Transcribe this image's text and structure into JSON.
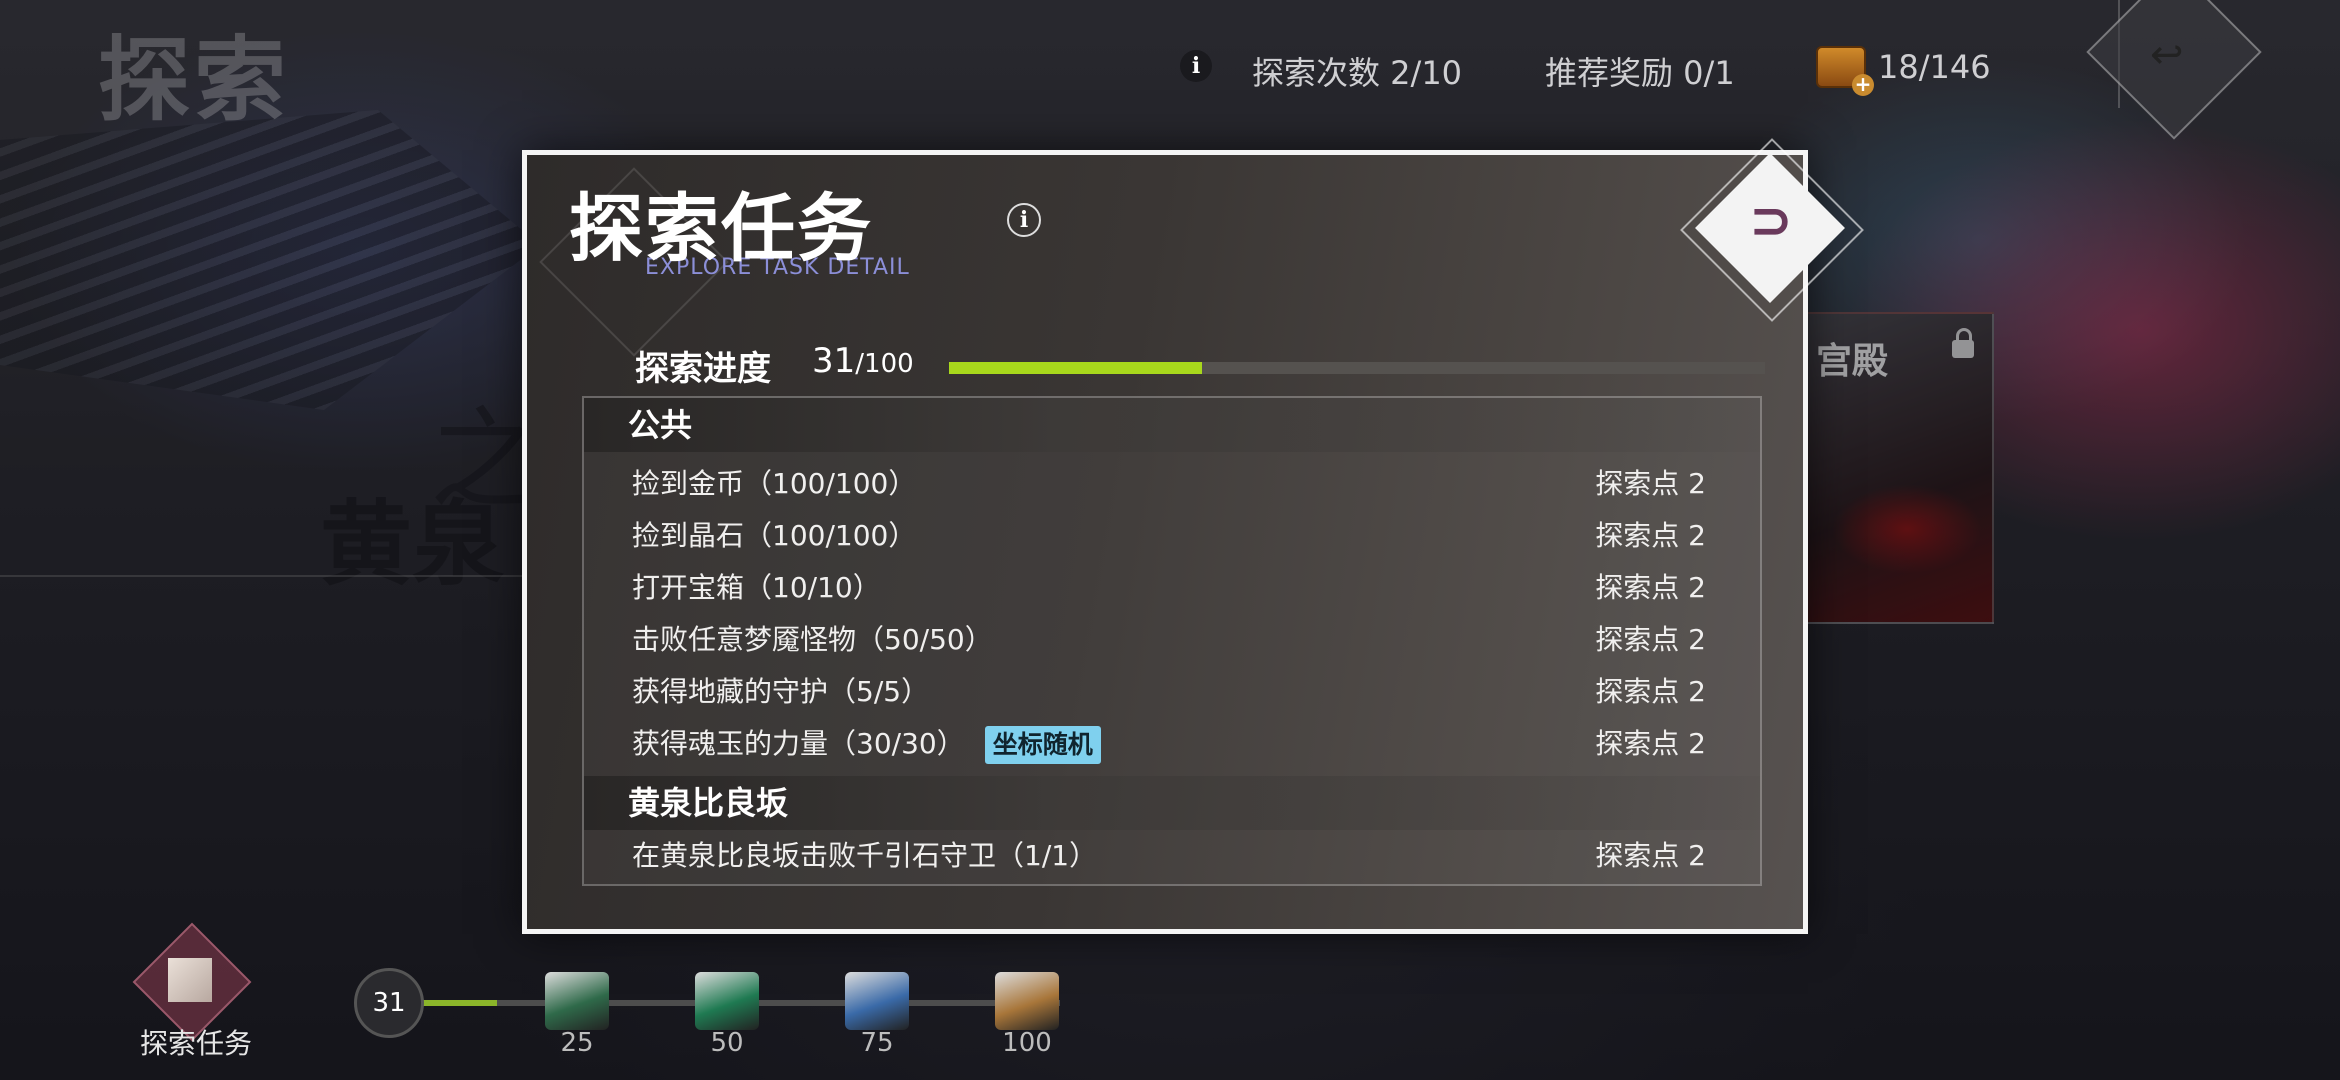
{
  "background": {
    "title": "探索",
    "region_text": "黄泉",
    "zhi_char": "之",
    "card_title": "宫殿"
  },
  "hud": {
    "info_icon": "i",
    "explore_count": "探索次数 2/10",
    "recommended_reward": "推荐奖励 0/1",
    "chest_count": "18/146",
    "back_icon": "↩"
  },
  "modal": {
    "title": "探索任务",
    "subtitle": "EXPLORE TASK DETAIL",
    "info_icon": "i",
    "close_icon": "⊃",
    "progress_label": "探索进度",
    "progress_current": "31",
    "progress_total": "/100",
    "progress_fraction": 0.31,
    "sections": [
      {
        "name": "公共",
        "rows": [
          {
            "task": "捡到金币（100/100）",
            "points": "探索点 2"
          },
          {
            "task": "捡到晶石（100/100）",
            "points": "探索点 2"
          },
          {
            "task": "打开宝箱（10/10）",
            "points": "探索点 2"
          },
          {
            "task": "击败任意梦魇怪物（50/50）",
            "points": "探索点 2"
          },
          {
            "task": "获得地藏的守护（5/5）",
            "points": "探索点 2"
          },
          {
            "task": "获得魂玉的力量（30/30）",
            "points": "探索点 2",
            "tag": "坐标随机"
          }
        ]
      },
      {
        "name": "黄泉比良坂",
        "rows": [
          {
            "task": "在黄泉比良坂击败千引石守卫（1/1）",
            "points": "探索点 2"
          }
        ]
      }
    ]
  },
  "bottom": {
    "label": "探索任务",
    "level": "31",
    "track_fraction": 0.12,
    "rewards": [
      {
        "value": "25",
        "color": "#2f6a4a"
      },
      {
        "value": "50",
        "color": "#1f7a52"
      },
      {
        "value": "75",
        "color": "#3a6aa8"
      },
      {
        "value": "100",
        "color": "#a8763a"
      }
    ]
  }
}
